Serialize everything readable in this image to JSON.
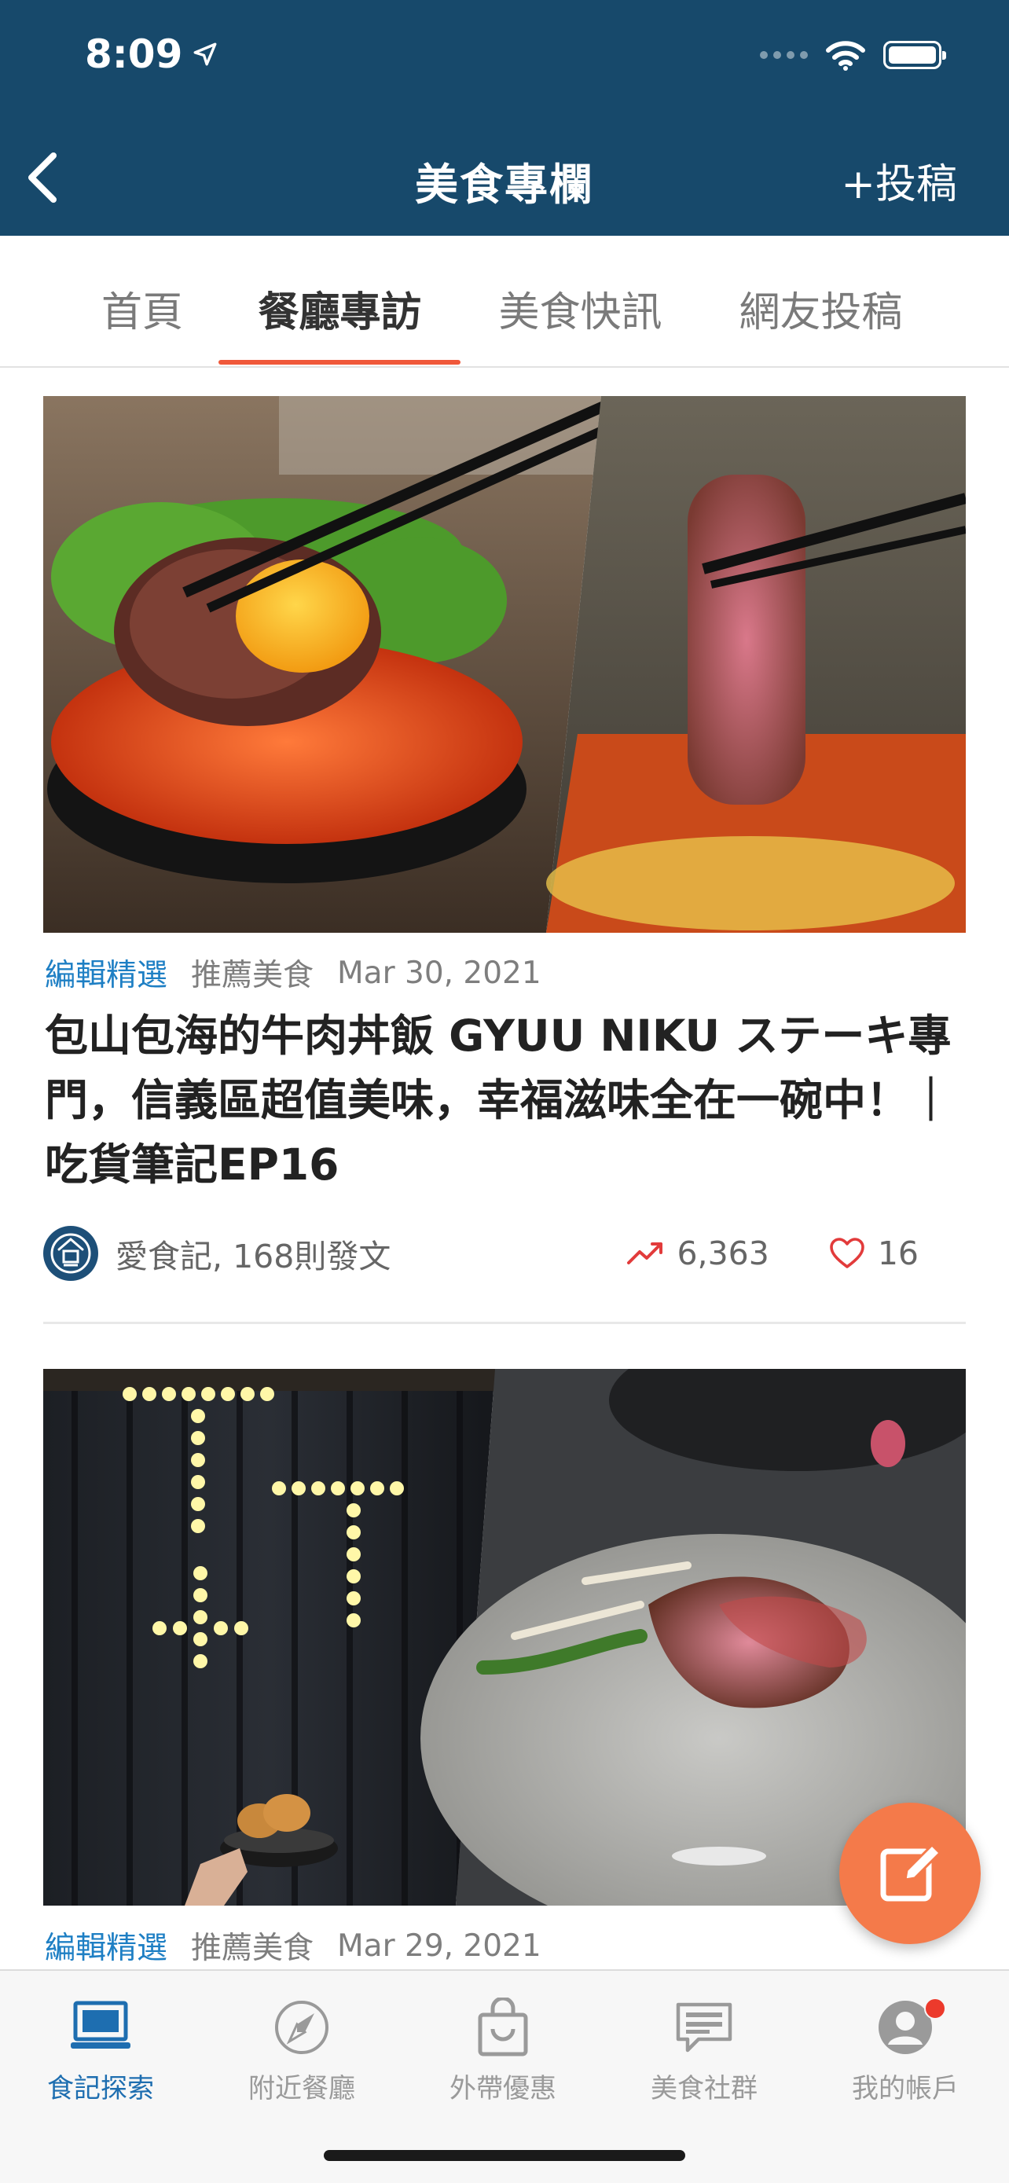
{
  "status_bar": {
    "time": "8:09"
  },
  "header": {
    "title": "美食專欄",
    "submit_label": "+投稿"
  },
  "tabs": [
    {
      "label": "首頁"
    },
    {
      "label": "餐廳專訪"
    },
    {
      "label": "美食快訊"
    },
    {
      "label": "網友投稿"
    }
  ],
  "active_tab": "餐廳專訪",
  "articles": [
    {
      "editor_tag": "編輯精選",
      "category": "推薦美食",
      "date": "Mar 30, 2021",
      "title": "包山包海的牛肉丼飯 GYUU NIKU ステーキ專門，信義區超值美味，幸福滋味全在一碗中！｜吃貨筆記EP16",
      "author": "愛食記, 168則發文",
      "views": "6,363",
      "likes": "16"
    },
    {
      "editor_tag": "編輯精選",
      "category": "推薦美食",
      "date": "Mar 29, 2021"
    }
  ],
  "bottom_nav": [
    {
      "label": "食記探索",
      "icon": "laptop-icon"
    },
    {
      "label": "附近餐廳",
      "icon": "compass-icon"
    },
    {
      "label": "外帶優惠",
      "icon": "bag-icon"
    },
    {
      "label": "美食社群",
      "icon": "chat-icon"
    },
    {
      "label": "我的帳戶",
      "icon": "user-icon"
    }
  ],
  "colors": {
    "header_bg": "#17496b",
    "tab_underline": "#f0583a",
    "editor_tag": "#1e7fc4",
    "nav_active": "#1e6eb0",
    "fab": "#f47a4a",
    "notification_badge": "#ec3a2c"
  }
}
